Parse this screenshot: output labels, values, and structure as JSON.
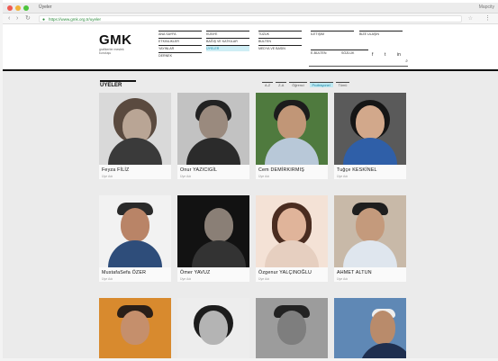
{
  "browser": {
    "tab_title": "Üyeler",
    "profile_label": "Mapcity",
    "url": "https://www.gmk.org.tr/uyeler",
    "back": "‹",
    "forward": "›",
    "reload": "↻",
    "lock": "●",
    "star": "☆",
    "menu": "⋮"
  },
  "header": {
    "logo": "GMK",
    "logo_subtitle": "grafikerler meslek kuruluşu",
    "nav_columns": [
      [
        "Ana sayfa",
        "Etkinlikler",
        "Yayınlar",
        "Dernek"
      ],
      [
        "Künye",
        "Bağış ve Katkılar",
        "Üyeler"
      ],
      [
        "Tüzük",
        "Bülten",
        "Medya ve Basın"
      ],
      [
        "İletişim",
        "E-bülten"
      ],
      [
        "Bize Ulaşın",
        "Sözlük"
      ],
      [
        "Giriş"
      ]
    ],
    "active_nav": "Üyeler",
    "social_icons": [
      "f",
      "t",
      "in"
    ],
    "search_icon": "⌕"
  },
  "page": {
    "section_title": "ÜYELER",
    "filters": [
      "A-Z",
      "Z-A",
      "Öğrenci",
      "Profesyonel",
      "Tümü"
    ],
    "active_filter": "Profesyonel"
  },
  "members": [
    {
      "name": "Feyza FİLİZ",
      "role": "Üye Adı"
    },
    {
      "name": "Onur YAZICIGİL",
      "role": "Üye Adı"
    },
    {
      "name": "Cem DEMİRKIRMIŞ",
      "role": "Üye Adı"
    },
    {
      "name": "Tuğçe KESKİNEL",
      "role": "Üye Adı"
    },
    {
      "name": "MustafaSefa ÖZER",
      "role": "Üye Adı"
    },
    {
      "name": "Ömer YAVUZ",
      "role": "Üye Adı"
    },
    {
      "name": "Özgenur YALÇINOĞLU",
      "role": "Üye Adı"
    },
    {
      "name": "AHMET ALTUN",
      "role": "Üye Adı"
    },
    {
      "name": "",
      "role": ""
    },
    {
      "name": "",
      "role": ""
    },
    {
      "name": "",
      "role": ""
    },
    {
      "name": "",
      "role": ""
    }
  ],
  "colors": {
    "accent": "#1c8fb0",
    "accent_bg": "#cfeef5",
    "content_bg": "#ebebeb"
  }
}
